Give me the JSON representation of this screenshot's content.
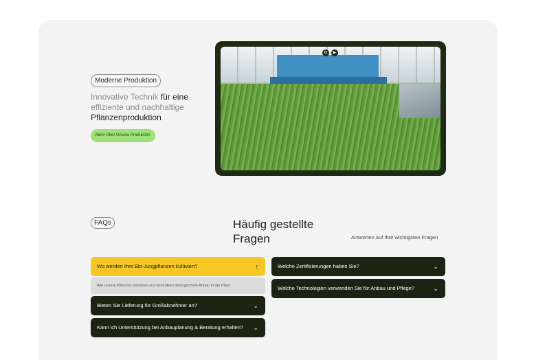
{
  "production": {
    "pill": "Moderne Produktion",
    "title_light_1": "Innovative Technik ",
    "title_dark_1": "für eine",
    "title_light_2": "effiziente und nachhaltige",
    "title_dark_2": "Pflanzenproduktion",
    "cta_label": "Mehr Über Unsere Produktion"
  },
  "media": {
    "controls": [
      "settings-icon",
      "play-icon"
    ]
  },
  "faq": {
    "pill": "FAQs",
    "title": "Häufig gestellte Fragen",
    "subtitle": "Antworten auf Ihre wichtigsten Fragen",
    "left": [
      {
        "q": "Wo werden Ihre Bio-Jungpflanzen kultiviert?",
        "open": true,
        "a": "Alle unsere Pflanzen stammen aus kontrolliert ökologischem Anbau in der Pfalz."
      },
      {
        "q": "Bieten Sie Lieferung für Großabnehmer an?",
        "open": false
      },
      {
        "q": "Kann ich Unterstützung bei Anbauplanung & Beratung erhalten?",
        "open": false
      }
    ],
    "right": [
      {
        "q": "Welche Zertifizierungen haben Sie?",
        "open": false
      },
      {
        "q": "Welche Technologien verwenden Sie für Anbau und Pflege?",
        "open": false
      }
    ]
  },
  "colors": {
    "accent_green": "#9ee07a",
    "faq_dark": "#1c2313",
    "faq_open": "#f6c625",
    "frame": "#1e2a14"
  }
}
